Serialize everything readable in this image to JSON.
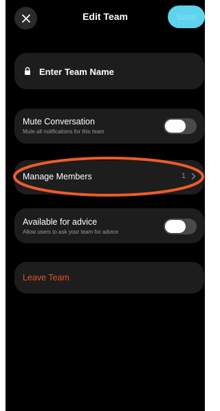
{
  "header": {
    "title": "Edit Team",
    "save_label": "Save"
  },
  "team_name": {
    "placeholder": "Enter Team Name",
    "value": ""
  },
  "mute": {
    "title": "Mute Conversation",
    "subtitle": "Mute all notifications for this team",
    "enabled": false
  },
  "members": {
    "label": "Manage Members",
    "count": "1"
  },
  "advice": {
    "title": "Available for advice",
    "subtitle": "Allow users to ask your team for advice",
    "enabled": false
  },
  "leave": {
    "label": "Leave Team"
  },
  "colors": {
    "background": "#000000",
    "card": "#1d1d1d",
    "accent": "#5fd3ec",
    "danger": "#e0542c",
    "highlight": "#ee5b2a"
  },
  "icons": {
    "close": "close-icon",
    "lock": "lock-icon",
    "chevron": "chevron-right-icon"
  }
}
